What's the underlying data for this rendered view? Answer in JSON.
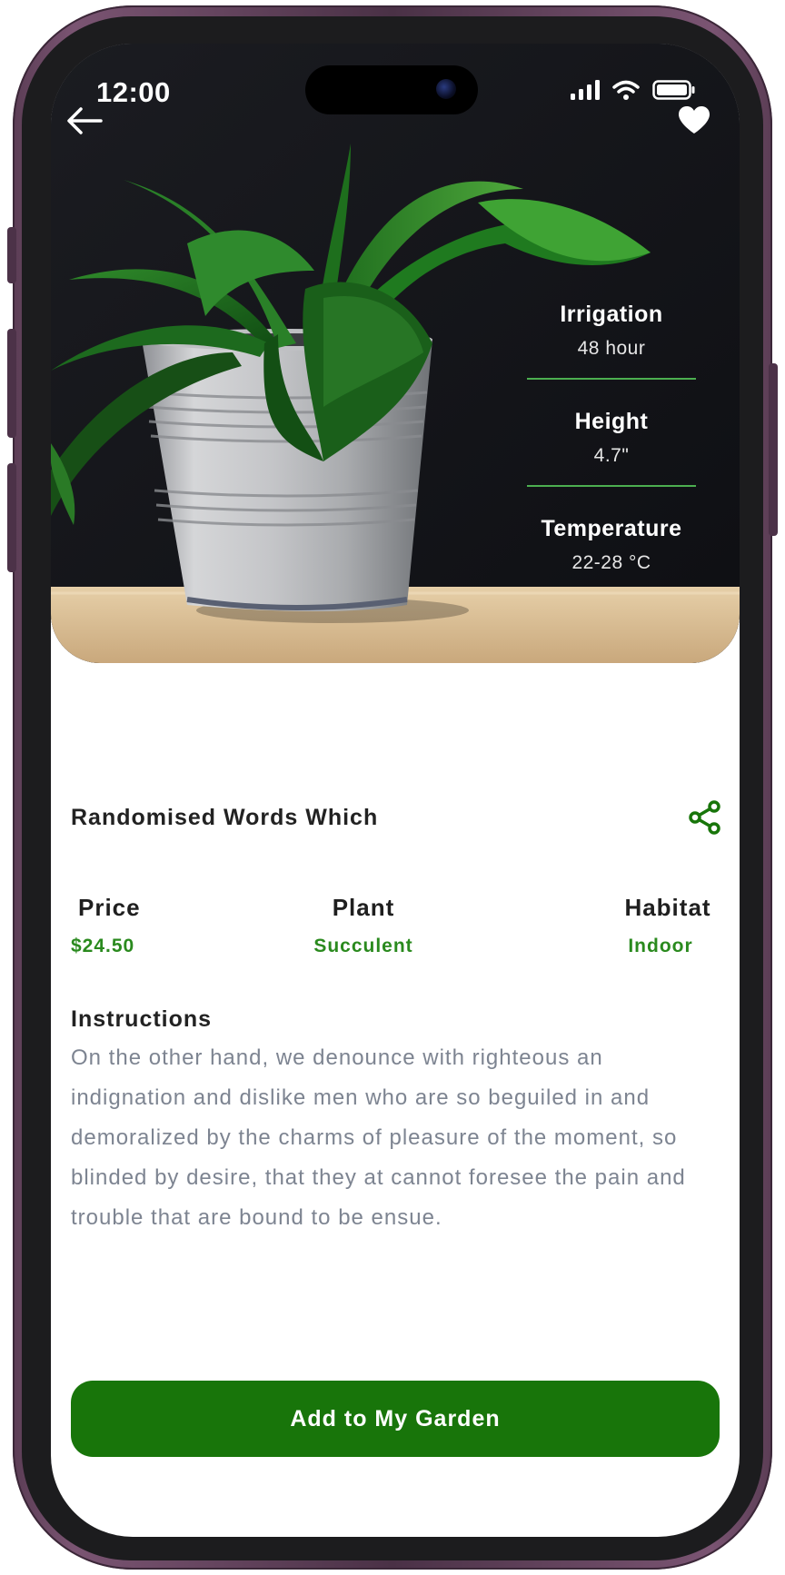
{
  "status_bar": {
    "time": "12:00",
    "icons": [
      "signal-icon",
      "wifi-icon",
      "battery-icon"
    ]
  },
  "header": {
    "back_icon": "arrow-left-icon",
    "favorite_icon": "heart-icon"
  },
  "plant_stats": [
    {
      "label": "Irrigation",
      "value": "48 hour"
    },
    {
      "label": "Height",
      "value": "4.7\""
    },
    {
      "label": "Temperature",
      "value": "22-28 °C"
    }
  ],
  "product": {
    "title": "Randomised Words Which",
    "share_icon": "share-icon"
  },
  "attributes": [
    {
      "label": "Price",
      "value": "$24.50"
    },
    {
      "label": "Plant",
      "value": "Succulent"
    },
    {
      "label": "Habitat",
      "value": "Indoor"
    }
  ],
  "instructions": {
    "title": "Instructions",
    "text": "On the other hand, we denounce with righteous an indignation and dislike men who are so beguiled in and demoralized by the charms of pleasure of the moment, so blinded by desire, that they at cannot foresee the pain and trouble that are bound to be ensue."
  },
  "cta": {
    "label": "Add to My Garden"
  },
  "colors": {
    "accent": "#18750a",
    "accent_text": "#2a8a1e",
    "divider": "#4caf50",
    "body_text": "#7d8491",
    "frame": "#5b3d55"
  }
}
